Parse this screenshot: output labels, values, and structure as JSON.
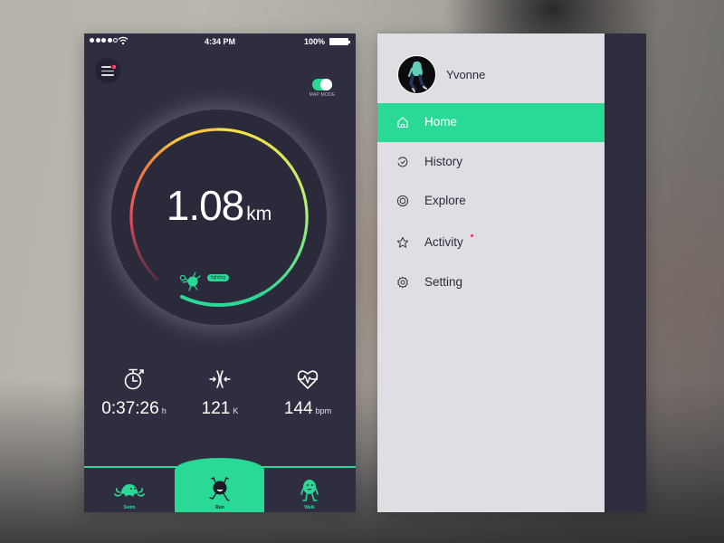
{
  "colors": {
    "accent": "#2bd997",
    "phone_bg": "#2f2e40",
    "drawer_bg": "#dfdfe3",
    "notification": "#ff3e6c",
    "gauge_gradient": [
      "#e3485b",
      "#f28b3b",
      "#f7d649",
      "#c8f064",
      "#2bd997"
    ]
  },
  "status_bar": {
    "signal_bars": 4,
    "signal_total": 5,
    "wifi_icon": "wifi-icon",
    "time": "4:34 PM",
    "battery": "100%"
  },
  "tracker": {
    "menu_icon": "hamburger-menu-icon",
    "map_mode": {
      "label": "MAP MODE",
      "enabled": true
    },
    "distance": {
      "value": "1.08",
      "unit": "km"
    },
    "cheer": "fighting",
    "progress_fraction": 0.72,
    "stats": [
      {
        "icon": "stopwatch-icon",
        "value": "0:37:26",
        "unit": "h"
      },
      {
        "icon": "cadence-icon",
        "value": "121",
        "unit": "K"
      },
      {
        "icon": "heart-rate-icon",
        "value": "144",
        "unit": "bpm"
      }
    ],
    "tabs": [
      {
        "label": "Swim",
        "icon": "swim-mascot-icon",
        "active": false
      },
      {
        "label": "Run",
        "icon": "run-mascot-icon",
        "active": true
      },
      {
        "label": "Walk",
        "icon": "walk-mascot-icon",
        "active": false
      }
    ]
  },
  "drawer": {
    "user": {
      "name": "Yvonne",
      "avatar": "user-avatar"
    },
    "items": [
      {
        "label": "Home",
        "icon": "home-icon",
        "active": true,
        "badge": false
      },
      {
        "label": "History",
        "icon": "history-icon",
        "active": false,
        "badge": false
      },
      {
        "label": "Explore",
        "icon": "explore-icon",
        "active": false,
        "badge": false
      },
      {
        "label": "Activity",
        "icon": "star-icon",
        "active": false,
        "badge": true
      },
      {
        "label": "Setting",
        "icon": "gear-icon",
        "active": false,
        "badge": false
      }
    ]
  }
}
